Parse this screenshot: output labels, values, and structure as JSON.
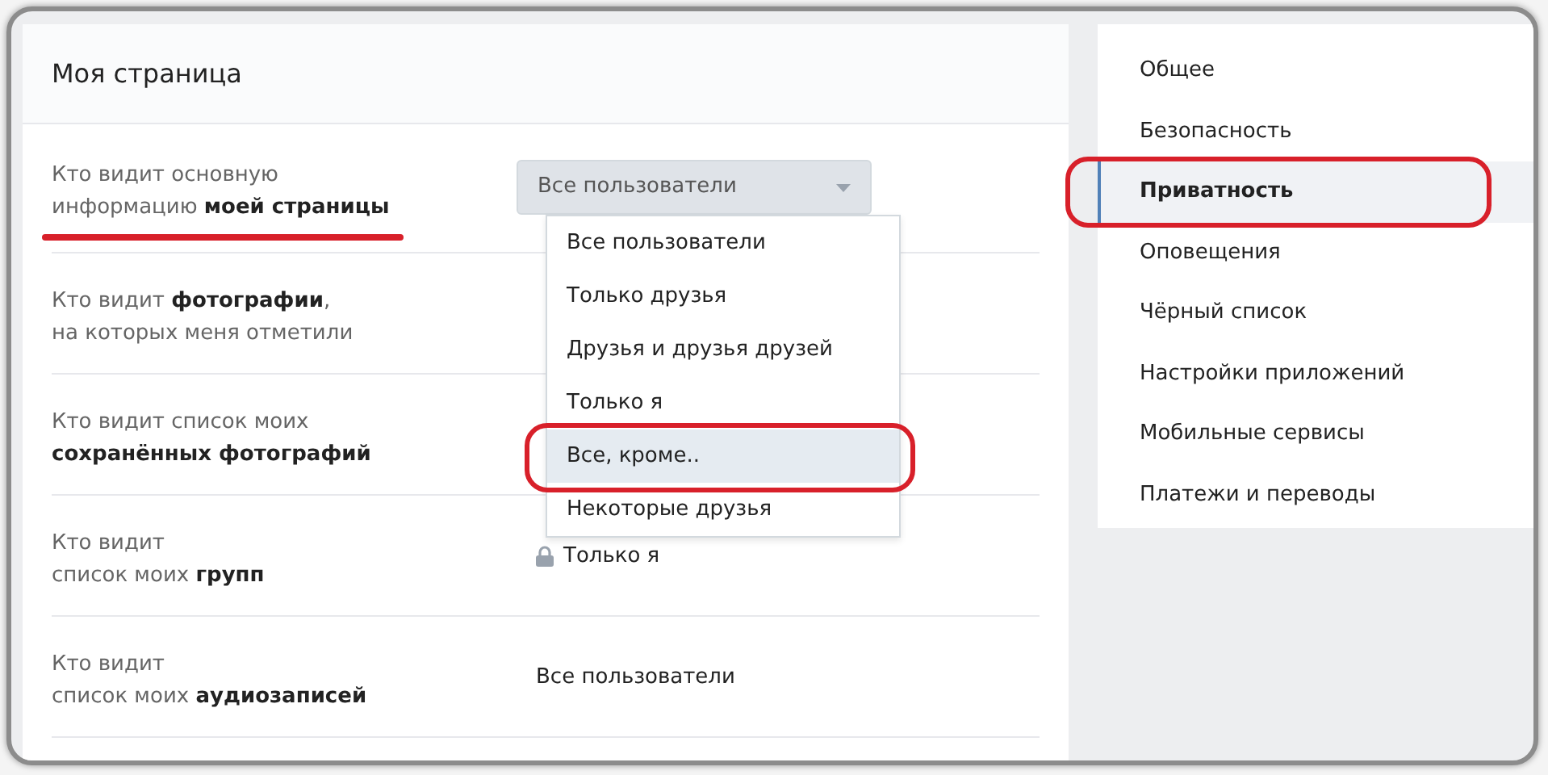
{
  "main": {
    "title": "Моя страница",
    "rows": [
      {
        "label": "Кто видит основную\nинформацию **моей страницы**",
        "underlined": true,
        "kind": "select",
        "value": "Все пользователи",
        "expanded": true,
        "options": [
          {
            "label": "Все пользователи",
            "highlighted": false,
            "circled": false
          },
          {
            "label": "Только друзья",
            "highlighted": false,
            "circled": false
          },
          {
            "label": "Друзья и друзья друзей",
            "highlighted": false,
            "circled": false
          },
          {
            "label": "Только я",
            "highlighted": false,
            "circled": false
          },
          {
            "label": "Все, кроме..",
            "highlighted": true,
            "circled": true
          },
          {
            "label": "Некоторые друзья",
            "highlighted": false,
            "circled": false
          }
        ]
      },
      {
        "label": "Кто видит **фотографии**,\nна которых меня отметили",
        "underlined": false,
        "kind": "hidden"
      },
      {
        "label": "Кто видит список моих\n**сохранённых фотографий**",
        "underlined": false,
        "kind": "hidden"
      },
      {
        "label": "Кто видит\nсписок моих **групп**",
        "underlined": false,
        "kind": "locked",
        "value": "Только я"
      },
      {
        "label": "Кто видит\nсписок моих **аудиозаписей**",
        "underlined": false,
        "kind": "text",
        "value": "Все пользователи"
      }
    ]
  },
  "sidebar": {
    "items": [
      {
        "label": "Общее",
        "selected": false,
        "circled": false
      },
      {
        "label": "Безопасность",
        "selected": false,
        "circled": false
      },
      {
        "label": "Приватность",
        "selected": true,
        "circled": true
      },
      {
        "label": "Оповещения",
        "selected": false,
        "circled": false
      },
      {
        "label": "Чёрный список",
        "selected": false,
        "circled": false
      },
      {
        "label": "Настройки приложений",
        "selected": false,
        "circled": false
      },
      {
        "label": "Мобильные сервисы",
        "selected": false,
        "circled": false
      },
      {
        "label": "Платежи и переводы",
        "selected": false,
        "circled": false
      }
    ]
  }
}
